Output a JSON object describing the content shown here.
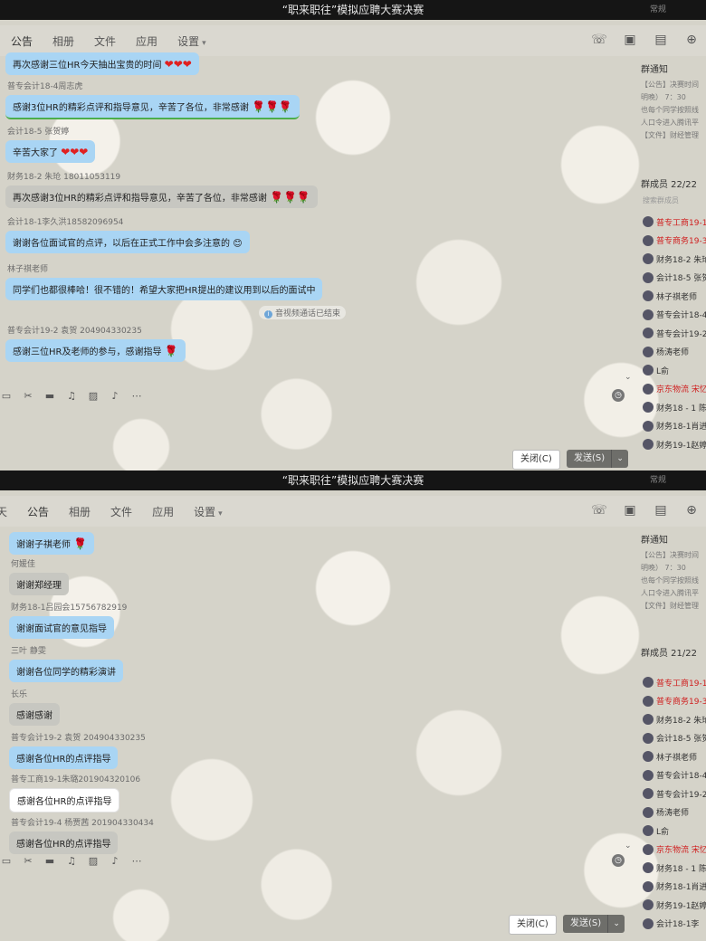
{
  "screen1": {
    "title": "“职来职往”模拟应聘大赛决赛",
    "corner_text": "常规",
    "tabs": [
      "公告",
      "相册",
      "文件",
      "应用",
      "设置"
    ],
    "messages": [
      {
        "sender": "",
        "text": "再次感谢三位HR今天抽出宝贵的时间",
        "emoji": "❤❤❤",
        "style": "blue"
      },
      {
        "sender": "普专会计18-4周志虎",
        "text": "感谢3位HR的精彩点评和指导意见，辛苦了各位，非常感谢",
        "emoji": "🌹🌹🌹",
        "style": "green"
      },
      {
        "sender": "会计18-5 张贺婷",
        "text": "辛苦大家了",
        "emoji": "❤❤❤",
        "style": "blue"
      },
      {
        "sender": "财务18-2 朱玱 18011053119",
        "text": "再次感谢3位HR的精彩点评和指导意见，辛苦了各位，非常感谢",
        "emoji": "🌹🌹🌹",
        "style": "grey"
      },
      {
        "sender": "会计18-1李久洪18582096954",
        "text": "谢谢各位面试官的点评，以后在正式工作中会多注意的",
        "emoji": "😊",
        "style": "blue"
      },
      {
        "sender": "林子祺老师",
        "text": "同学们也都很棒哈！很不错的！希望大家把HR提出的建议用到以后的面试中",
        "emoji": "",
        "style": "blue"
      },
      {
        "sender": "普专会计19-2 袁贺 204904330235",
        "text": "感谢三位HR及老师的参与，感谢指导",
        "emoji": "🌹",
        "style": "blue"
      }
    ],
    "system_note": "音视频通话已结束",
    "panel": {
      "notice_title": "群通知",
      "notice_lines": [
        "【公告】决赛时间",
        "明晚） 7：30",
        "也每个同学按照线",
        "人口令进入腾讯平",
        "【文件】财经管理"
      ],
      "members_title": "群成员 22/22",
      "search_placeholder": "搜索群成员",
      "members": [
        {
          "name": "普专工商19-1",
          "red": true
        },
        {
          "name": "普专商务19-3",
          "red": true
        },
        {
          "name": "财务18-2 朱玱",
          "red": false
        },
        {
          "name": "会计18-5 张贺",
          "red": false
        },
        {
          "name": "林子祺老师",
          "red": false
        },
        {
          "name": "普专会计18-4",
          "red": false
        },
        {
          "name": "普专会计19-2",
          "red": false
        },
        {
          "name": "杨涛老师",
          "red": false
        },
        {
          "name": "L俞",
          "red": false
        },
        {
          "name": "京东物流 宋忆",
          "red": true
        },
        {
          "name": "财务18 - 1 陈",
          "red": false
        },
        {
          "name": "财务18-1肖进",
          "red": false
        },
        {
          "name": "财务19-1赵婷",
          "red": false
        }
      ]
    },
    "btn_close": "关闭(C)",
    "btn_send": "发送(S)"
  },
  "screen2": {
    "title": "“职来职往”模拟应聘大赛决赛",
    "corner_text": "常规",
    "tabs": [
      "天",
      "公告",
      "相册",
      "文件",
      "应用",
      "设置"
    ],
    "messages": [
      {
        "sender": "",
        "text": "谢谢子祺老师",
        "emoji": "🌹",
        "style": "blue"
      },
      {
        "sender": "何媛佳",
        "text": "谢谢郑经理",
        "emoji": "",
        "style": "grey"
      },
      {
        "sender": "财务18-1吕园会15756782919",
        "text": "谢谢面试官的意见指导",
        "emoji": "",
        "style": "blue"
      },
      {
        "sender": "三叶 静雯",
        "text": "谢谢各位同学的精彩演讲",
        "emoji": "",
        "style": "blue"
      },
      {
        "sender": "长乐",
        "text": "感谢感谢",
        "emoji": "",
        "style": "grey"
      },
      {
        "sender": "普专会计19-2 袁贺 204904330235",
        "text": "感谢各位HR的点评指导",
        "emoji": "",
        "style": "blue"
      },
      {
        "sender": "普专工商19-1朱璐201904320106",
        "text": "感谢各位HR的点评指导",
        "emoji": "",
        "style": "white"
      },
      {
        "sender": "普专会计19-4 杨贾茜 201904330434",
        "text": "感谢各位HR的点评指导",
        "emoji": "",
        "style": "grey"
      }
    ],
    "panel": {
      "notice_title": "群通知",
      "notice_lines": [
        "【公告】决赛时间",
        "明晚） 7：30",
        "也每个同学按照线",
        "人口令进入腾讯平",
        "【文件】财经管理"
      ],
      "members_title": "群成员 21/22",
      "members": [
        {
          "name": "普专工商19-1",
          "red": true
        },
        {
          "name": "普专商务19-3",
          "red": true
        },
        {
          "name": "财务18-2 朱玱",
          "red": false
        },
        {
          "name": "会计18-5 张贺",
          "red": false
        },
        {
          "name": "林子祺老师",
          "red": false
        },
        {
          "name": "普专会计18-4",
          "red": false
        },
        {
          "name": "普专会计19-2",
          "red": false
        },
        {
          "name": "杨涛老师",
          "red": false
        },
        {
          "name": "L俞",
          "red": false
        },
        {
          "name": "京东物流 宋忆",
          "red": true
        },
        {
          "name": "财务18 - 1 陈",
          "red": false
        },
        {
          "name": "财务18-1肖进",
          "red": false
        },
        {
          "name": "财务19-1赵婷",
          "red": false
        },
        {
          "name": "会计18-1李",
          "red": false
        }
      ]
    },
    "btn_close": "关闭(C)",
    "btn_send": "发送(S)"
  },
  "icons": [
    "phone-icon",
    "video-icon",
    "screen-share-icon",
    "add-icon",
    "emoji-icon",
    "scissors-icon",
    "folder-icon",
    "music-icon",
    "image-icon",
    "bell-icon",
    "more-icon",
    "clock-icon"
  ]
}
